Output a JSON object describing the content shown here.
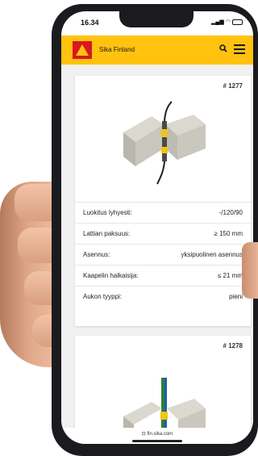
{
  "status": {
    "time": "16.34"
  },
  "header": {
    "brand": "Sika Finland"
  },
  "cards": [
    {
      "id": "# 1277",
      "specs": [
        {
          "label": "Luokitus lyhyesti:",
          "value": "-/120/90"
        },
        {
          "label": "Lattian paksuus:",
          "value": "≥ 150 mm"
        },
        {
          "label": "Asennus:",
          "value": "yksipuolinen asennus"
        },
        {
          "label": "Kaapelin halkaisija:",
          "value": "≤ 21 mm"
        },
        {
          "label": "Aukon tyyppi:",
          "value": "pieni"
        }
      ]
    },
    {
      "id": "# 1278"
    }
  ],
  "urlbar": {
    "url": "fin.sika.com"
  },
  "colors": {
    "brand_yellow": "#ffc20e",
    "brand_red": "#d71920"
  }
}
